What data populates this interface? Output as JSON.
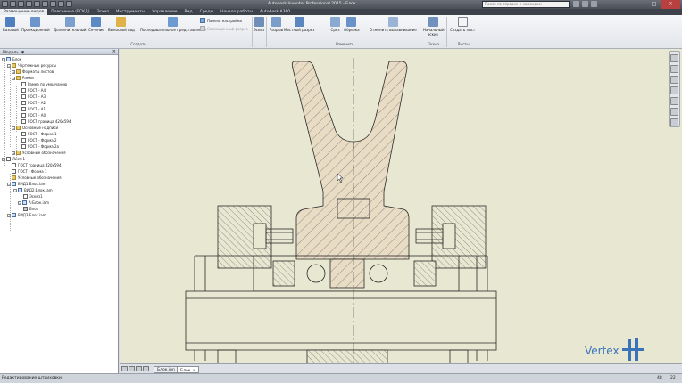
{
  "titlebar": {
    "title": "Autodesk Inventor Professional 2015 - Блок",
    "search_placeholder": "Поиск по справке и командам"
  },
  "tabs": [
    {
      "label": "Размещение видов",
      "active": true
    },
    {
      "label": "Пояснения (ЕСКД)"
    },
    {
      "label": "Эскиз"
    },
    {
      "label": "Инструменты"
    },
    {
      "label": "Управление"
    },
    {
      "label": "Вид"
    },
    {
      "label": "Среды"
    },
    {
      "label": "Начало работы"
    },
    {
      "label": "Autodesk A360"
    }
  ],
  "ribbon": {
    "create_buttons": [
      {
        "label": "Базовый"
      },
      {
        "label": "Проекционный"
      },
      {
        "label": "Дополнительный"
      },
      {
        "label": "Сечение"
      },
      {
        "label": "Выносной вид"
      },
      {
        "label": "Последовательное представление"
      }
    ],
    "overlay_label": "Панель настройки",
    "overlay_disabled_label": "Совмещенный разрез",
    "create_panel": "Создать",
    "sketch_label": "Эскиз",
    "modify_buttons": [
      {
        "label": "Разрыв"
      },
      {
        "label": "Местный разрез"
      },
      {
        "label": "Срез"
      },
      {
        "label": "Обрезка"
      }
    ],
    "modify_panel": "Изменить",
    "align_label": "Отменить выравнивание",
    "sheet_start_label": "Начальный эскиз",
    "sheet_panel": "Эскиз",
    "new_sheet_label": "Создать лист",
    "sheets_panel": "Листы"
  },
  "browser": {
    "title": "Модель",
    "nodes": [
      "Блок",
      "Чертежные ресурсы",
      "Форматы листов",
      "Рамки",
      "Рамка по умолчанию",
      "ГОСТ - А4",
      "ГОСТ - А3",
      "ГОСТ - А2",
      "ГОСТ - А1",
      "ГОСТ - А0",
      "ГОСТ граница 420х594",
      "Основные надписи",
      "ГОСТ - Форма 1",
      "ГОСТ - Форма 2",
      "ГОСТ - Форма 2а",
      "Условные обозначения",
      "Лист:1",
      "ГОСТ граница 420х594",
      "ГОСТ - Форма 1",
      "Условные обозначения",
      "ВИД1:Блок.iam",
      "ВИД2:Блок.iam",
      "Эскиз1",
      "А:Блок.iam",
      "Блок",
      "ВИД3:Блок.iam"
    ]
  },
  "sheet_tabs": {
    "tabs": [
      {
        "label": "Блок.ipn"
      },
      {
        "label": "Блок",
        "active": true
      }
    ]
  },
  "status": {
    "message": "Редактирование штриховки",
    "count1": "48",
    "count2": "22"
  },
  "watermark": {
    "text": "Vertex"
  },
  "colors": {
    "canvas": "#e8e8d2",
    "hatch_fill": "#e9dcc5",
    "line": "#2a2a2a",
    "accent": "#3a73b8"
  }
}
